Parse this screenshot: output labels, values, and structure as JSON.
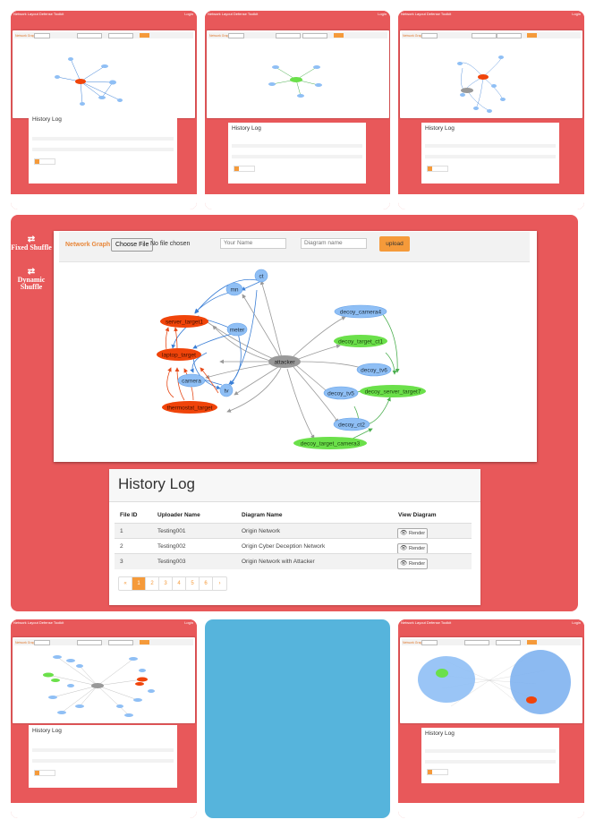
{
  "app": {
    "brand": "Network Layout Defense Toolkit",
    "nav_right": "Login"
  },
  "sidebar": {
    "fixed_shuffle": "Fixed Shuffle",
    "dynamic_shuffle": "Dynamic Shuffle"
  },
  "toolbar": {
    "label": "Network Graph",
    "choose_file": "Choose File",
    "no_file": "No file chosen",
    "name_placeholder": "Your Name",
    "diagram_placeholder": "Diagram name",
    "upload": "upload"
  },
  "graph": {
    "nodes": {
      "ct": "ct",
      "mn": "mn",
      "server_target": "server_target1",
      "laptop_target": "laptop_target",
      "meter": "meter",
      "camera": "camera",
      "tv": "tv",
      "thermostat_target": "thermostat_target",
      "attacker": "attacker",
      "decoy_camera4": "decoy_camera4",
      "decoy_target_ct1": "decoy_target_ct1",
      "decoy_tv6": "decoy_tv6",
      "decoy_server_target7": "decoy_server_target7",
      "decoy_tv5": "decoy_tv5",
      "decoy_ct2": "decoy_ct2",
      "decoy_target_camera3": "decoy_target_camera3"
    },
    "colors": {
      "normal": "#8fbff5",
      "target": "#f0440a",
      "decoy_target": "#6be04a",
      "attacker": "#999999",
      "blue_edge": "#3b7fd6",
      "red_edge": "#e64a19",
      "green_edge": "#4caf50",
      "gray_edge": "#999999"
    }
  },
  "history": {
    "title": "History Log",
    "columns": [
      "File ID",
      "Uploader Name",
      "Diagram Name",
      "View Diagram"
    ],
    "rows": [
      {
        "id": "1",
        "uploader": "Testing001",
        "diagram": "Origin Network",
        "action": "Render"
      },
      {
        "id": "2",
        "uploader": "Testing002",
        "diagram": "Origin Cyber Deception Network",
        "action": "Render"
      },
      {
        "id": "3",
        "uploader": "Testing003",
        "diagram": "Origin Network with Attacker",
        "action": "Render"
      }
    ],
    "pager": [
      "«",
      "1",
      "2",
      "3",
      "4",
      "5",
      "6",
      "›"
    ]
  },
  "accent": "#f59a3a",
  "tile_bg": "#e8585a",
  "blank_tile": "#56b4dc"
}
